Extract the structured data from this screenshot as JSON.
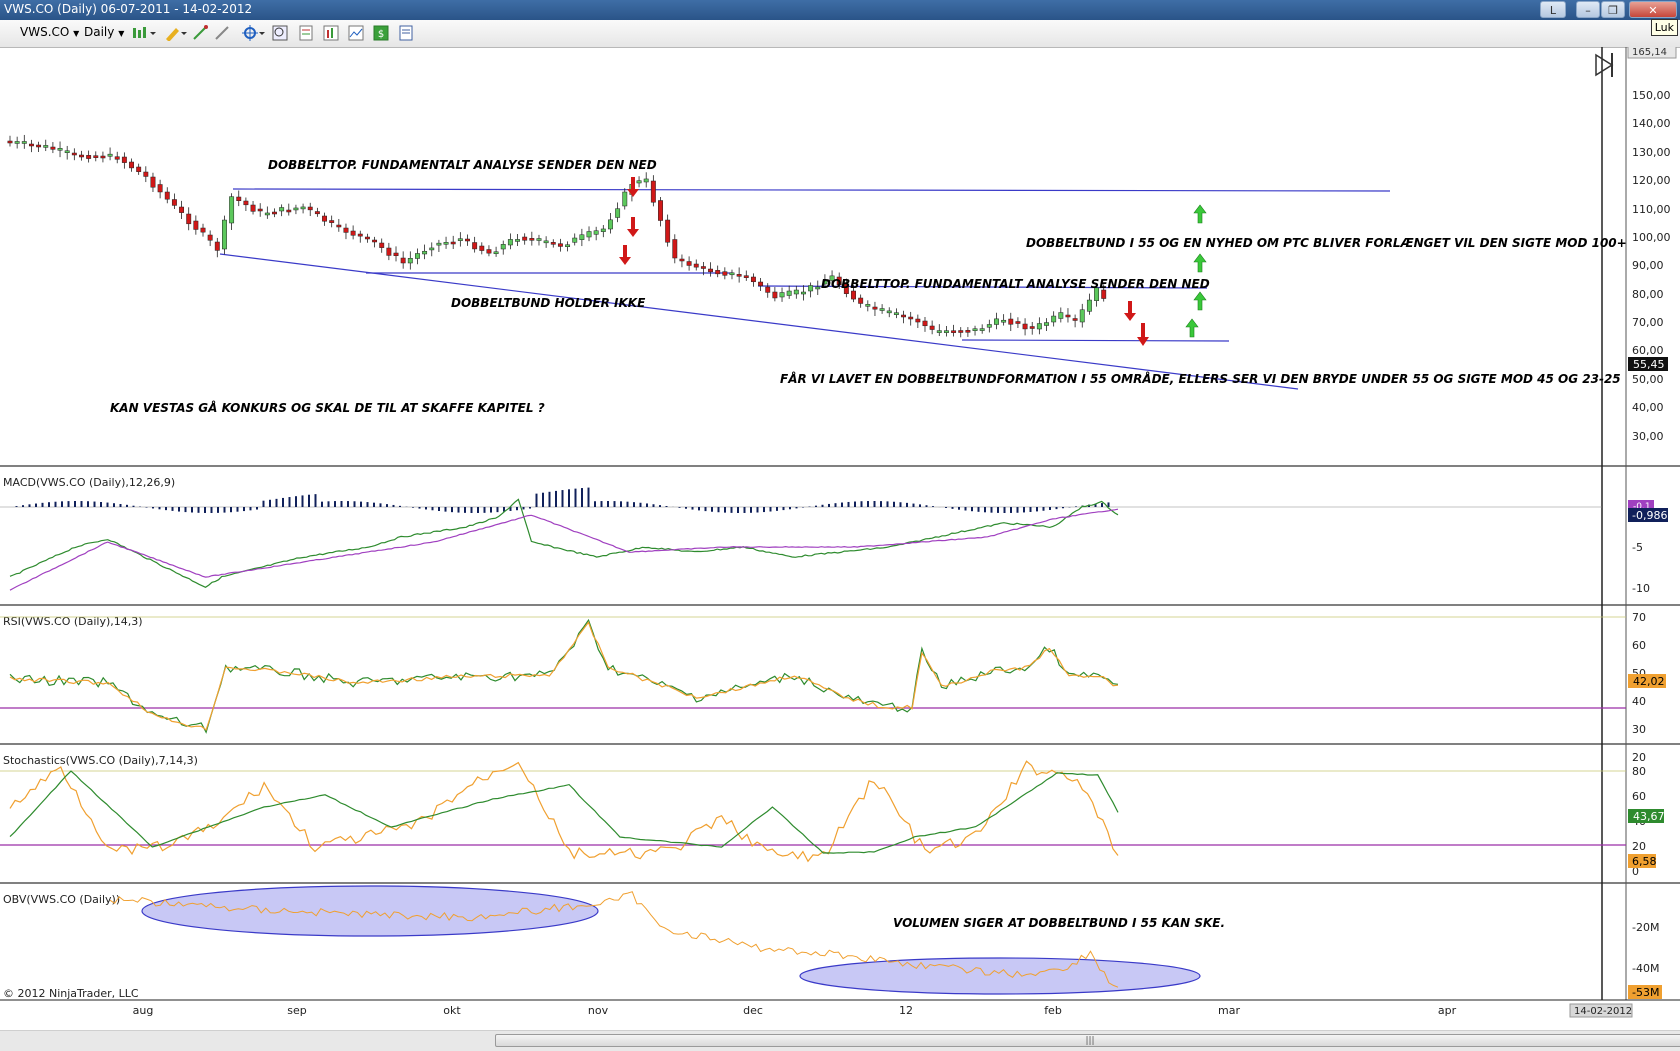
{
  "window": {
    "title": "VWS.CO (Daily)  06-07-2011 - 14-02-2012",
    "lang_button": "L",
    "tooltip": "Luk"
  },
  "toolbar": {
    "instrument": "VWS.CO",
    "interval": "Daily",
    "icons": [
      "bar-type-icon",
      "drawing-pencil-icon",
      "ruler-icon",
      "cross-icon",
      "crosshair-icon",
      "zoom-icon",
      "properties-icon",
      "indicators-icon",
      "strategies-icon",
      "dollar-icon",
      "print-icon"
    ]
  },
  "price_axis": {
    "labels": [
      "150,00",
      "140,00",
      "130,00",
      "120,00",
      "110,00",
      "100,00",
      "90,00",
      "80,00",
      "70,00",
      "60,00",
      "50,00",
      "40,00",
      "30,00"
    ],
    "top_value": "165,14",
    "last_price": "55,45"
  },
  "macd": {
    "label": "MACD(VWS.CO (Daily),12,26,9)",
    "axis_labels": [
      "-5",
      "-10"
    ],
    "value_top": "-0,1",
    "value": "-0,986"
  },
  "rsi": {
    "label": "RSI(VWS.CO (Daily),14,3)",
    "axis_labels": [
      "70",
      "60",
      "50",
      "40",
      "30",
      "20"
    ],
    "value": "42,02"
  },
  "stochastics": {
    "label": "Stochastics(VWS.CO (Daily),7,14,3)",
    "axis_labels": [
      "80",
      "60",
      "40",
      "20",
      "0"
    ],
    "value_d": "43,67",
    "value_k": "6,58"
  },
  "obv": {
    "label": "OBV(VWS.CO (Daily))",
    "axis_labels": [
      "-20M",
      "-40M"
    ],
    "value": "-53M"
  },
  "time_axis": {
    "labels": [
      "aug",
      "sep",
      "okt",
      "nov",
      "dec",
      "12",
      "feb",
      "mar",
      "apr"
    ],
    "end_date": "14-02-2012"
  },
  "copyright": "© 2012 NinjaTrader, LLC",
  "annotations": {
    "double_top_1": "DOBBELTTOP. FUNDAMENTALT ANALYSE SENDER DEN NED",
    "double_bottom_fail": "DOBBELTBUND HOLDER IKKE",
    "bankruptcy": "KAN VESTAS GÅ KONKURS OG SKAL DE TIL AT SKAFFE KAPITEL ?",
    "double_bottom_55_ptc": "DOBBELTBUND I 55 OG EN NYHED OM PTC BLIVER FORLÆNGET VIL DEN SIGTE MOD 100+",
    "double_top_2": "DOBBELTTOP. FUNDAMENTALT ANALYSE SENDER DEN NED",
    "bottom_formation": "FÅR VI LAVET EN DOBBELTBUNDFORMATION I 55 OMRÅDE, ELLERS SER VI DEN BRYDE UNDER 55 OG SIGTE MOD 45 OG 23-25",
    "volume": "VOLUMEN SIGER AT DOBBELTBUND I 55 KAN SKE."
  },
  "colors": {
    "up_candle": "#5cc85c",
    "down_candle": "#d01818",
    "trend_line": "#3a3ac8",
    "macd_line": "#2e8b2e",
    "signal_line": "#a040c0",
    "rsi_line": "#2e8b2e",
    "rsi_avg": "#f0a030",
    "level_line": "#9a2ea8",
    "obv_line": "#f0a030",
    "ellipse_fill": "#c8c8f5"
  }
}
